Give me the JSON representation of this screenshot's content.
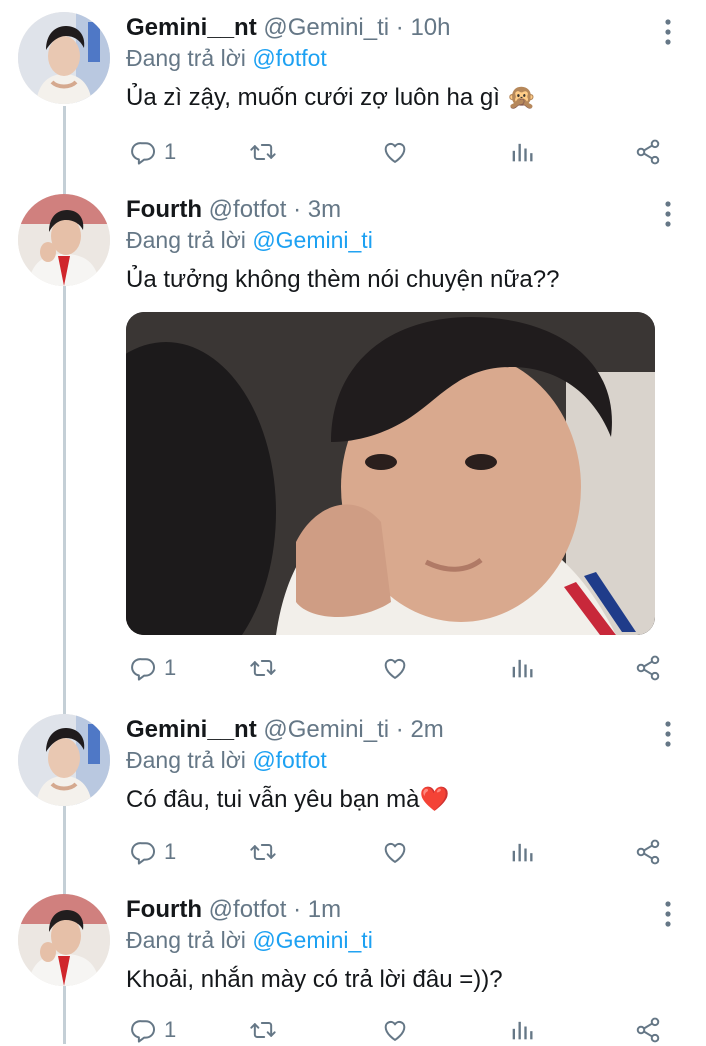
{
  "tweets": [
    {
      "name": "Gemini__nt",
      "handle": "@Gemini_ti",
      "dot": "·",
      "time": "10h",
      "reply_prefix": "Đang trả lời",
      "reply_to": "@fotfot",
      "text": "Ủa zì zậy, muốn cưới zợ luôn ha gì 🙊",
      "reply_count": "1"
    },
    {
      "name": "Fourth",
      "handle": "@fotfot",
      "dot": "·",
      "time": "3m",
      "reply_prefix": "Đang trả lời",
      "reply_to": "@Gemini_ti",
      "text": "Ủa tưởng không thèm nói chuyện nữa??",
      "reply_count": "1"
    },
    {
      "name": "Gemini__nt",
      "handle": "@Gemini_ti",
      "dot": "·",
      "time": "2m",
      "reply_prefix": "Đang trả lời",
      "reply_to": "@fotfot",
      "text": "Có đâu, tui vẫn yêu bạn mà❤️",
      "reply_count": "1"
    },
    {
      "name": "Fourth",
      "handle": "@fotfot",
      "dot": "·",
      "time": "1m",
      "reply_prefix": "Đang trả lời",
      "reply_to": "@Gemini_ti",
      "text": "Khoải, nhắn mày có trả lời đâu =))?",
      "reply_count": "1"
    }
  ],
  "colors": {
    "text": "#14171a",
    "secondary": "#657786",
    "link": "#1da1f2",
    "thread_line": "#c4cfd6"
  },
  "icons": {
    "reply": "reply-icon",
    "retweet": "retweet-icon",
    "like": "heart-icon",
    "analytics": "analytics-icon",
    "share": "share-icon",
    "more": "more-vertical-icon"
  }
}
